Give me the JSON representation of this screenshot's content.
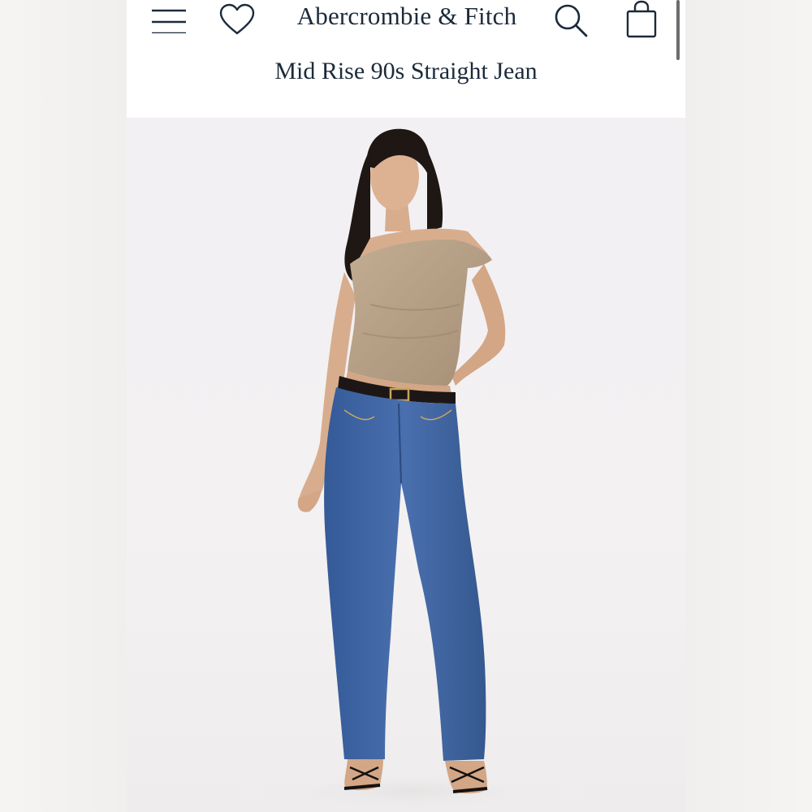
{
  "header": {
    "brand": "Abercrombie & Fitch",
    "icons": {
      "menu": "hamburger-menu-icon",
      "wishlist": "heart-icon",
      "search": "search-icon",
      "bag": "shopping-bag-icon"
    }
  },
  "product": {
    "title": "Mid Rise 90s Straight Jean"
  },
  "colors": {
    "text": "#1c2a3a",
    "denim": "#3f64a3",
    "top": "#b5a088"
  }
}
